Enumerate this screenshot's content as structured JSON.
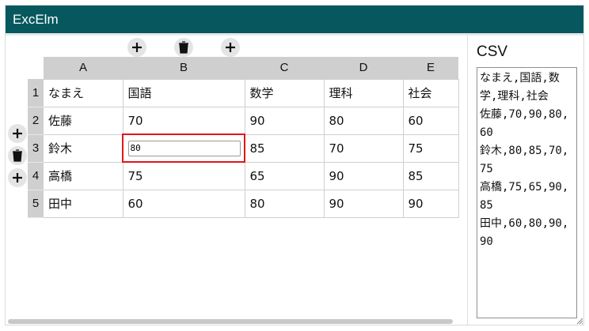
{
  "app": {
    "title": "ExcElm"
  },
  "toolbar": {
    "add_col_left_icon": "plus-icon",
    "delete_col_icon": "trash-icon",
    "add_col_right_icon": "plus-icon",
    "add_row_above_icon": "plus-icon",
    "delete_row_icon": "trash-icon",
    "add_row_below_icon": "plus-icon"
  },
  "sheet": {
    "columns": [
      "A",
      "B",
      "C",
      "D",
      "E"
    ],
    "rows": [
      {
        "num": "1",
        "cells": [
          "なまえ",
          "国語",
          "数学",
          "理科",
          "社会"
        ]
      },
      {
        "num": "2",
        "cells": [
          "佐藤",
          "70",
          "90",
          "80",
          "60"
        ]
      },
      {
        "num": "3",
        "cells": [
          "鈴木",
          "80",
          "85",
          "70",
          "75"
        ]
      },
      {
        "num": "4",
        "cells": [
          "高橋",
          "75",
          "65",
          "90",
          "85"
        ]
      },
      {
        "num": "5",
        "cells": [
          "田中",
          "60",
          "80",
          "90",
          "90"
        ]
      }
    ],
    "editing": {
      "row": 3,
      "col": "B",
      "value": "80"
    },
    "selection_color": "#e0161b",
    "header_color": "#cfcfcf"
  },
  "csv": {
    "title": "CSV",
    "text": "なまえ,国語,数学,理科,社会\n佐藤,70,90,80,60\n鈴木,80,85,70,75\n高橋,75,65,90,85\n田中,60,80,90,90"
  },
  "theme": {
    "titlebar_color": "#06585e"
  }
}
